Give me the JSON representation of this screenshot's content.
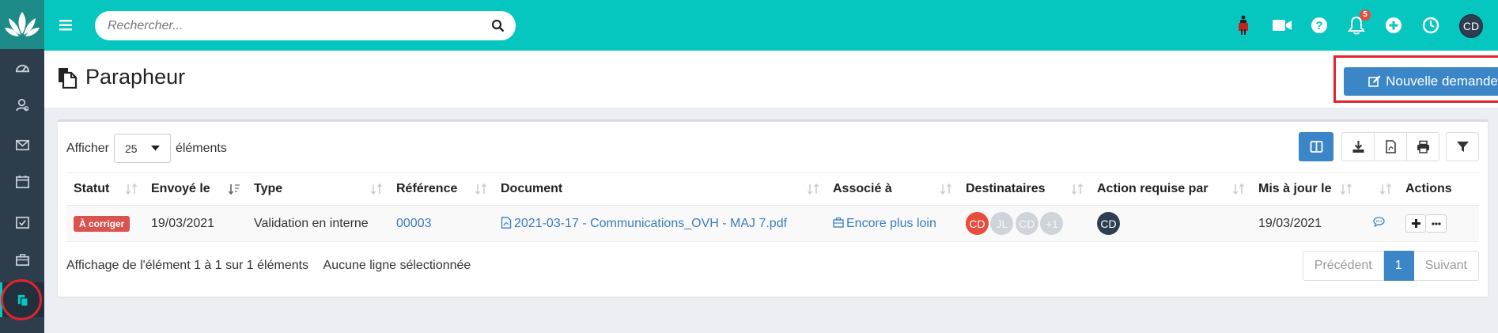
{
  "header": {
    "search_placeholder": "Rechercher...",
    "notification_count": "5",
    "user_initials": "CD"
  },
  "page": {
    "title": "Parapheur",
    "new_button_label": "Nouvelle demande"
  },
  "table_controls": {
    "show_label": "Afficher",
    "page_size": "25",
    "elements_label": "éléments"
  },
  "table": {
    "columns": [
      "Statut",
      "Envoyé le",
      "Type",
      "Référence",
      "Document",
      "Associé à",
      "Destinataires",
      "Action requise par",
      "Mis à jour le",
      "",
      "Actions"
    ],
    "rows": [
      {
        "status": "À corriger",
        "sent_on": "19/03/2021",
        "type": "Validation en interne",
        "reference": "00003",
        "document": "2021-03-17 - Communications_OVH - MAJ 7.pdf",
        "associated": "Encore plus loin",
        "recipients": [
          "CD",
          "JL",
          "CD",
          "+1"
        ],
        "action_by": "CD",
        "updated_on": "19/03/2021"
      }
    ]
  },
  "footer": {
    "info": "Affichage de l'élément 1 à 1 sur 1 éléments",
    "selection": "Aucune ligne sélectionnée",
    "prev": "Précédent",
    "page": "1",
    "next": "Suivant"
  },
  "colors": {
    "topbar": "#06c7bf",
    "sidebar": "#2e3d4c",
    "primary": "#3a86c6",
    "danger": "#d9534f",
    "highlight": "#e3232c"
  }
}
